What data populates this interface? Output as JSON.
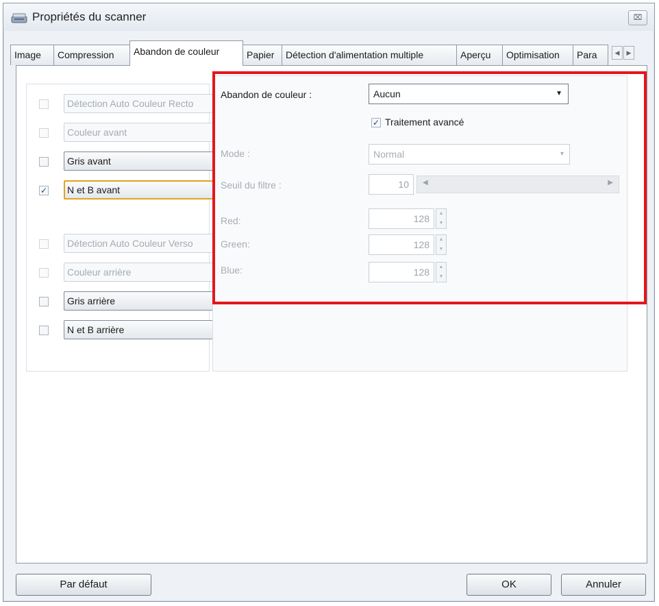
{
  "window": {
    "title": "Propriétés du scanner",
    "close_glyph": "⌧"
  },
  "tabs": [
    {
      "label": "Image"
    },
    {
      "label": "Compression"
    },
    {
      "label": "Abandon de couleur"
    },
    {
      "label": "Papier"
    },
    {
      "label": "Détection d'alimentation multiple"
    },
    {
      "label": "Aperçu"
    },
    {
      "label": "Optimisation"
    },
    {
      "label": "Para"
    }
  ],
  "active_tab": "Abandon de couleur",
  "image_list": [
    {
      "label": "Détection Auto Couleur Recto",
      "checked": false,
      "enabled": false
    },
    {
      "label": "Couleur avant",
      "checked": false,
      "enabled": false
    },
    {
      "label": "Gris avant",
      "checked": false,
      "enabled": true
    },
    {
      "label": "N et B avant",
      "checked": true,
      "enabled": true,
      "selected": true
    },
    {
      "label": "Détection Auto Couleur Verso",
      "checked": false,
      "enabled": false
    },
    {
      "label": "Couleur arrière",
      "checked": false,
      "enabled": false
    },
    {
      "label": "Gris arrière",
      "checked": false,
      "enabled": true
    },
    {
      "label": "N et B arrière",
      "checked": false,
      "enabled": true
    }
  ],
  "settings": {
    "color_dropout_label": "Abandon de couleur :",
    "color_dropout_value": "Aucun",
    "advanced_label": "Traitement avancé",
    "advanced_checked": true,
    "mode_label": "Mode :",
    "mode_value": "Normal",
    "threshold_label": "Seuil du filtre :",
    "threshold_value": "10",
    "red_label": "Red:",
    "red_value": "128",
    "green_label": "Green:",
    "green_value": "128",
    "blue_label": "Blue:",
    "blue_value": "128"
  },
  "buttons": {
    "default_label": "Par défaut",
    "ok_label": "OK",
    "cancel_label": "Annuler"
  },
  "colors": {
    "highlight_box": "#e4161c",
    "selected_item_border": "#e0a31f"
  }
}
